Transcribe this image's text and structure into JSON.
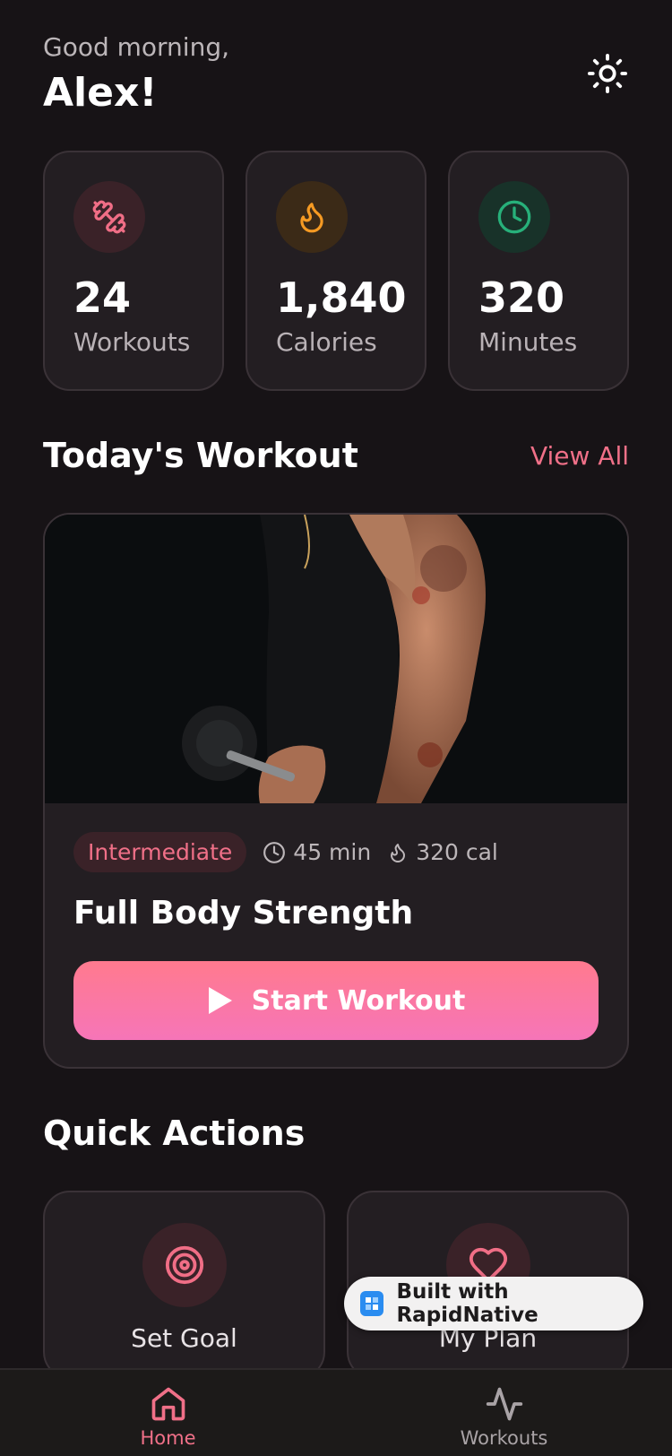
{
  "header": {
    "greeting": "Good morning,",
    "username": "Alex!",
    "theme_icon": "sun-icon"
  },
  "stats": [
    {
      "icon": "dumbbell-icon",
      "value": "24",
      "label": "Workouts",
      "color": "#f06e86",
      "bg": "#3a2228"
    },
    {
      "icon": "flame-icon",
      "value": "1,840",
      "label": "Calories",
      "color": "#f59a23",
      "bg": "#3b2a17"
    },
    {
      "icon": "clock-icon",
      "value": "320",
      "label": "Minutes",
      "color": "#27b07a",
      "bg": "#183229"
    }
  ],
  "today": {
    "title": "Today's Workout",
    "view_all": "View All",
    "workout": {
      "level": "Intermediate",
      "duration": "45 min",
      "calories": "320 cal",
      "name": "Full Body Strength",
      "start_label": "Start Workout"
    }
  },
  "quick_actions": {
    "title": "Quick Actions",
    "items": [
      {
        "icon": "target-icon",
        "label": "Set Goal"
      },
      {
        "icon": "heart-icon",
        "label": "My Plan"
      }
    ]
  },
  "badge": {
    "label": "Built with RapidNative"
  },
  "tabbar": {
    "items": [
      {
        "icon": "home-icon",
        "label": "Home",
        "active": true
      },
      {
        "icon": "activity-icon",
        "label": "Workouts",
        "active": false
      }
    ]
  },
  "colors": {
    "accent": "#f07088",
    "background": "#171316",
    "card": "#231e22"
  }
}
